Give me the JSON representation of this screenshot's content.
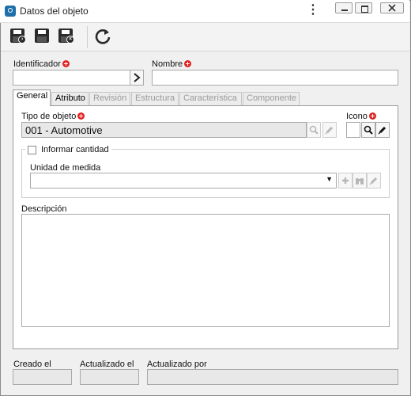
{
  "window": {
    "title": "Datos del objeto",
    "menu_glyph": "⋮"
  },
  "toolbar": {
    "buttons": [
      {
        "name": "save-and-new-button",
        "icon": "floppy-arrow-icon"
      },
      {
        "name": "save-button",
        "icon": "floppy-icon"
      },
      {
        "name": "save-and-close-button",
        "icon": "floppy-x-icon"
      },
      {
        "name": "refresh-button",
        "icon": "refresh-icon"
      }
    ]
  },
  "form": {
    "identifier_label": "Identificador",
    "identifier_value": "",
    "name_label": "Nombre",
    "name_value": ""
  },
  "tabs": [
    {
      "label": "General",
      "state": "active"
    },
    {
      "label": "Atributo",
      "state": "enabled"
    },
    {
      "label": "Revisión",
      "state": "disabled"
    },
    {
      "label": "Estructura",
      "state": "disabled"
    },
    {
      "label": "Característica",
      "state": "disabled"
    },
    {
      "label": "Componente",
      "state": "disabled"
    }
  ],
  "general": {
    "object_type_label": "Tipo de objeto",
    "object_type_value": "001 - Automotive",
    "icon_label": "Icono",
    "inform_quantity_label": "Informar cantidad",
    "inform_quantity_checked": false,
    "unit_label": "Unidad de medida",
    "unit_value": "",
    "description_label": "Descripción",
    "description_value": ""
  },
  "footer": {
    "created_label": "Creado el",
    "created_value": "",
    "updated_label": "Actualizado el",
    "updated_value": "",
    "updated_by_label": "Actualizado por",
    "updated_by_value": ""
  },
  "colors": {
    "required": "#e02020",
    "accent": "#1f6fa8"
  }
}
